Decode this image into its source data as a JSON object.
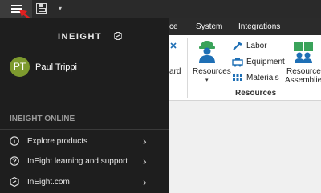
{
  "titlebar": {
    "menu_icon": "hamburger-icon",
    "save_icon": "save-icon",
    "quick_access_icon": "chevron-down-icon",
    "quick_access_glyph": "▾"
  },
  "ribbon": {
    "tabs": [
      {
        "label": "ce"
      },
      {
        "label": "System"
      },
      {
        "label": "Integrations"
      }
    ],
    "partial_button_label": "ard",
    "resources_button": {
      "label": "Resources",
      "caret": "▾",
      "icon": "worker-icon"
    },
    "small_items": [
      {
        "label": "Labor",
        "icon": "labor-icon"
      },
      {
        "label": "Equipment",
        "icon": "equipment-icon"
      },
      {
        "label": "Materials",
        "icon": "materials-icon"
      }
    ],
    "assemblies_button": {
      "label_line1": "Resource",
      "label_line2": "Assemblies",
      "icon": "assemblies-icon"
    },
    "group_label": "Resources"
  },
  "drawer": {
    "logo_text": "INEIGHT",
    "user": {
      "initials": "PT",
      "name": "Paul Trippi",
      "avatar_color": "#7d9a2e"
    },
    "section_title": "INEIGHT ONLINE",
    "items": [
      {
        "label": "Explore products",
        "icon": "info-icon",
        "chevron": "›"
      },
      {
        "label": "InEight learning and support",
        "icon": "help-icon",
        "chevron": "›"
      },
      {
        "label": "InEight.com",
        "icon": "ineight-logo-icon",
        "chevron": "›"
      }
    ]
  },
  "colors": {
    "titlebar_bg": "#2a2a2a",
    "drawer_bg": "#1e1e1e",
    "accent_blue": "#1e6fb5",
    "accent_green": "#3aa35a",
    "annotation_red": "#e02020"
  }
}
